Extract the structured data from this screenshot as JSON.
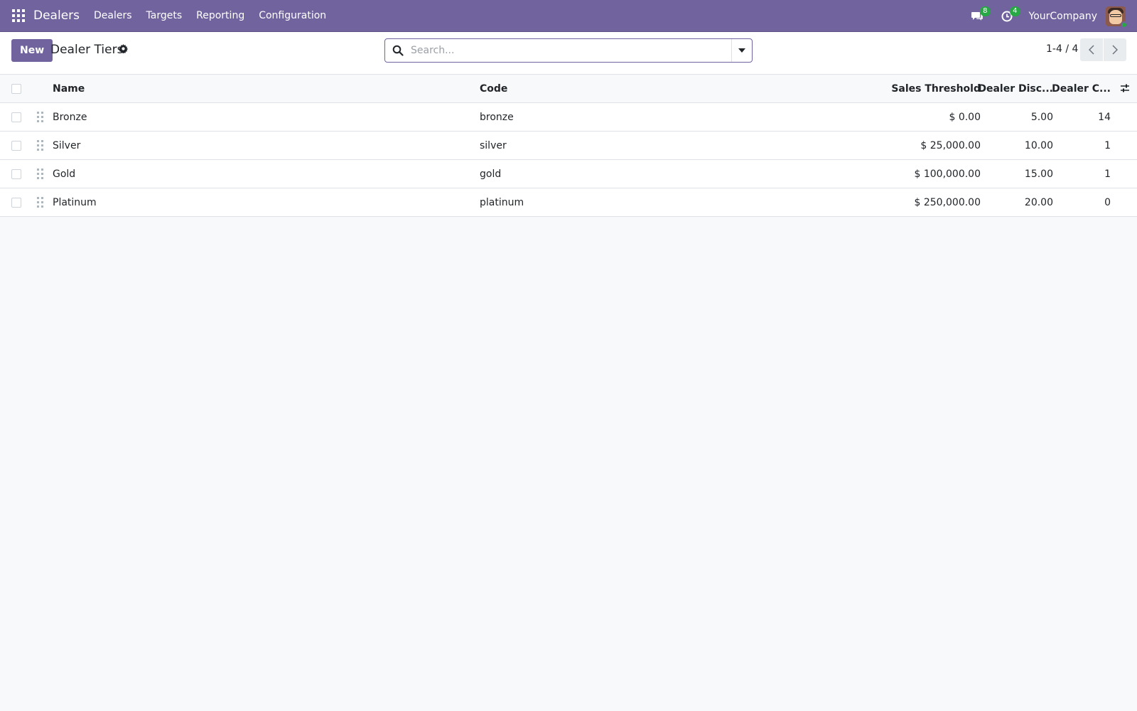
{
  "navbar": {
    "brand": "Dealers",
    "menu": [
      "Dealers",
      "Targets",
      "Reporting",
      "Configuration"
    ],
    "messages_badge": "8",
    "activities_badge": "4",
    "company": "YourCompany"
  },
  "control": {
    "new_label": "New",
    "title": "Dealer Tiers",
    "search_placeholder": "Search...",
    "pager": "1-4 / 4"
  },
  "table": {
    "headers": {
      "name": "Name",
      "code": "Code",
      "sales": "Sales Threshold",
      "discount": "Dealer Disc...",
      "count": "Dealer C..."
    },
    "rows": [
      {
        "name": "Bronze",
        "code": "bronze",
        "sales": "$ 0.00",
        "discount": "5.00",
        "count": "14"
      },
      {
        "name": "Silver",
        "code": "silver",
        "sales": "$ 25,000.00",
        "discount": "10.00",
        "count": "1"
      },
      {
        "name": "Gold",
        "code": "gold",
        "sales": "$ 100,000.00",
        "discount": "15.00",
        "count": "1"
      },
      {
        "name": "Platinum",
        "code": "platinum",
        "sales": "$ 250,000.00",
        "discount": "20.00",
        "count": "0"
      }
    ]
  },
  "colors": {
    "brand": "#71639e",
    "badge": "#28a745"
  }
}
